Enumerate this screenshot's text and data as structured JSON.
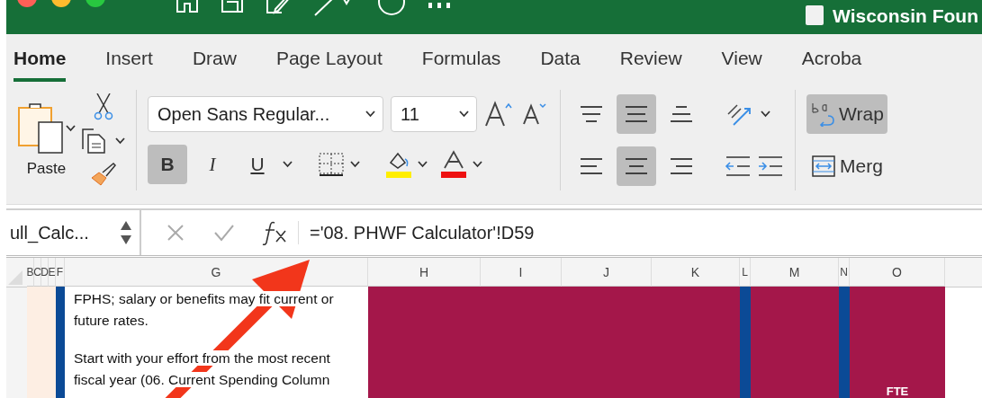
{
  "window": {
    "title": "Wisconsin Foun"
  },
  "ribbon_tabs": [
    {
      "label": "Home",
      "selected": true
    },
    {
      "label": "Insert",
      "selected": false
    },
    {
      "label": "Draw",
      "selected": false
    },
    {
      "label": "Page Layout",
      "selected": false
    },
    {
      "label": "Formulas",
      "selected": false
    },
    {
      "label": "Data",
      "selected": false
    },
    {
      "label": "Review",
      "selected": false
    },
    {
      "label": "View",
      "selected": false
    },
    {
      "label": "Acroba",
      "selected": false
    }
  ],
  "clipboard": {
    "paste_label": "Paste"
  },
  "font": {
    "name": "Open Sans Regular...",
    "size": "11"
  },
  "format_buttons": [
    {
      "label": "B",
      "selected": true
    },
    {
      "label": "I",
      "selected": false
    },
    {
      "label": "U",
      "selected": false
    }
  ],
  "vertical_align": [
    {
      "selected": false
    },
    {
      "selected": true
    },
    {
      "selected": false
    }
  ],
  "horizontal_align": [
    {
      "selected": false
    },
    {
      "selected": true
    },
    {
      "selected": false
    }
  ],
  "wrap_text": {
    "label": "Wrap",
    "selected": true
  },
  "merge": {
    "label": "Merg"
  },
  "formula_bar": {
    "name_box": "ull_Calc...",
    "formula": "='08. PHWF Calculator'!D59"
  },
  "columns": [
    {
      "label": "B",
      "kind": "margin"
    },
    {
      "label": "C",
      "kind": "margin"
    },
    {
      "label": "D",
      "kind": "margin"
    },
    {
      "label": "E",
      "kind": "margin"
    },
    {
      "label": "F",
      "kind": "divider"
    },
    {
      "label": "G",
      "kind": "text",
      "text": [
        "FPHS; salary or benefits may fit current or future rates.",
        "Start with your effort from the most recent fiscal year (06. Current Spending Column"
      ]
    },
    {
      "label": "H",
      "kind": "band"
    },
    {
      "label": "I",
      "kind": "band"
    },
    {
      "label": "J",
      "kind": "band"
    },
    {
      "label": "K",
      "kind": "band"
    },
    {
      "label": "L",
      "kind": "divider"
    },
    {
      "label": "M",
      "kind": "band"
    },
    {
      "label": "N",
      "kind": "divider"
    },
    {
      "label": "O",
      "kind": "band",
      "text": [
        "FTE"
      ]
    }
  ]
}
